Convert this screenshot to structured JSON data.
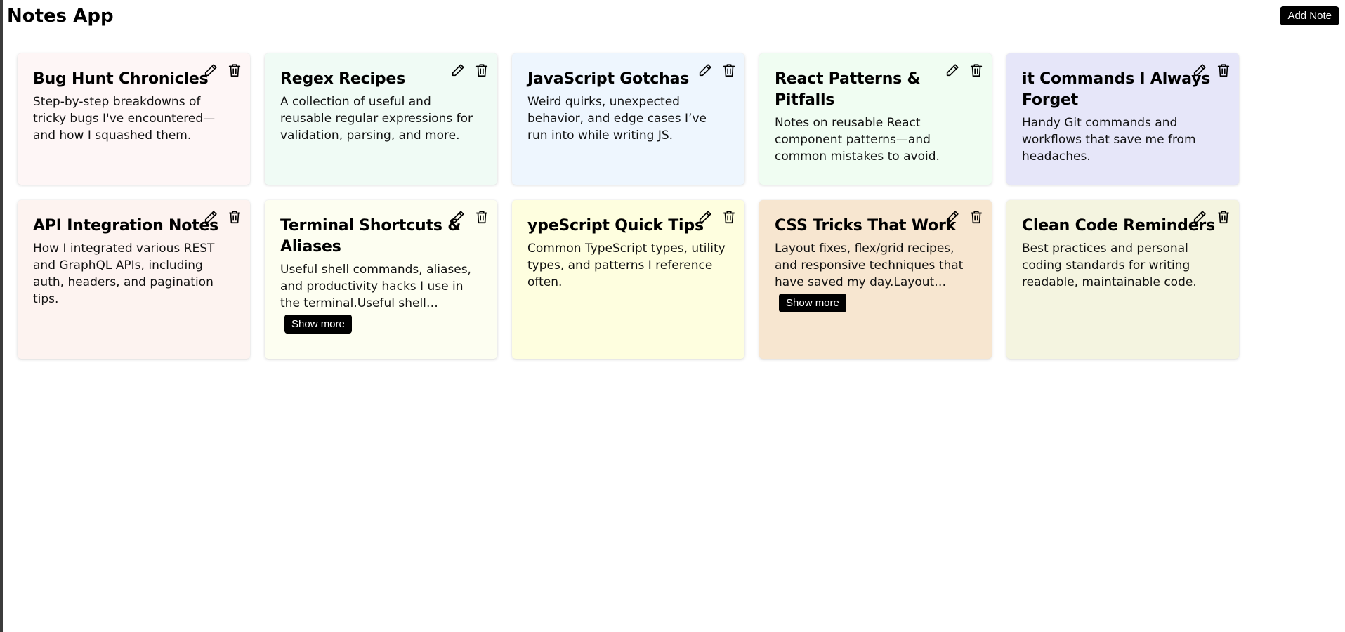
{
  "app": {
    "title": "Notes App",
    "add_note_label": "Add Note"
  },
  "colors": {
    "accent": "#000000",
    "card_backgrounds": [
      "#fef6f6",
      "#f0fbf5",
      "#eef6fe",
      "#f0fdf2",
      "#e6e6f9",
      "#fdf3f0",
      "#fdfef1",
      "#fefedf",
      "#f7e6d0",
      "#f4f4e0"
    ]
  },
  "icons": {
    "edit": "pencil-icon",
    "delete": "trash-icon"
  },
  "notes": [
    {
      "title": "Bug Hunt Chronicles",
      "body": "Step-by-step breakdowns of tricky bugs I've encountered—and how I squashed them.",
      "color": "#fef6f6"
    },
    {
      "title": "Regex Recipes",
      "body": "A collection of useful and reusable regular expressions for validation, parsing, and more.",
      "color": "#f0fbf5"
    },
    {
      "title": "JavaScript Gotchas",
      "body": "Weird quirks, unexpected behavior, and edge cases I’ve run into while writing JS.",
      "color": "#eef6fe"
    },
    {
      "title": "React Patterns & Pitfalls",
      "body": "Notes on reusable React component patterns—and common mistakes to avoid.",
      "color": "#f0fdf2"
    },
    {
      "title": "it Commands I Always Forget",
      "body": "Handy Git commands and workflows that save me from headaches.",
      "color": "#e6e6f9"
    },
    {
      "title": "API Integration Notes",
      "body": "How I integrated various REST and GraphQL APIs, including auth, headers, and pagination tips.",
      "color": "#fdf3f0"
    },
    {
      "title": "Terminal Shortcuts & Aliases",
      "body": "Useful shell commands, aliases, and productivity hacks I use in the terminal.Useful shell commands,...",
      "color": "#fdfef1",
      "show_more_label": "Show more"
    },
    {
      "title": "ypeScript Quick Tips",
      "body": "Common TypeScript types, utility types, and patterns I reference often.",
      "color": "#fefedf"
    },
    {
      "title": "CSS Tricks That Work",
      "body": "Layout fixes, flex/grid recipes, and responsive techniques that have saved my day.Layout fixes,...",
      "color": "#f7e6d0",
      "show_more_label": "Show more"
    },
    {
      "title": "Clean Code Reminders",
      "body": "Best practices and personal coding standards for writing readable, maintainable code.",
      "color": "#f4f4e0"
    }
  ]
}
